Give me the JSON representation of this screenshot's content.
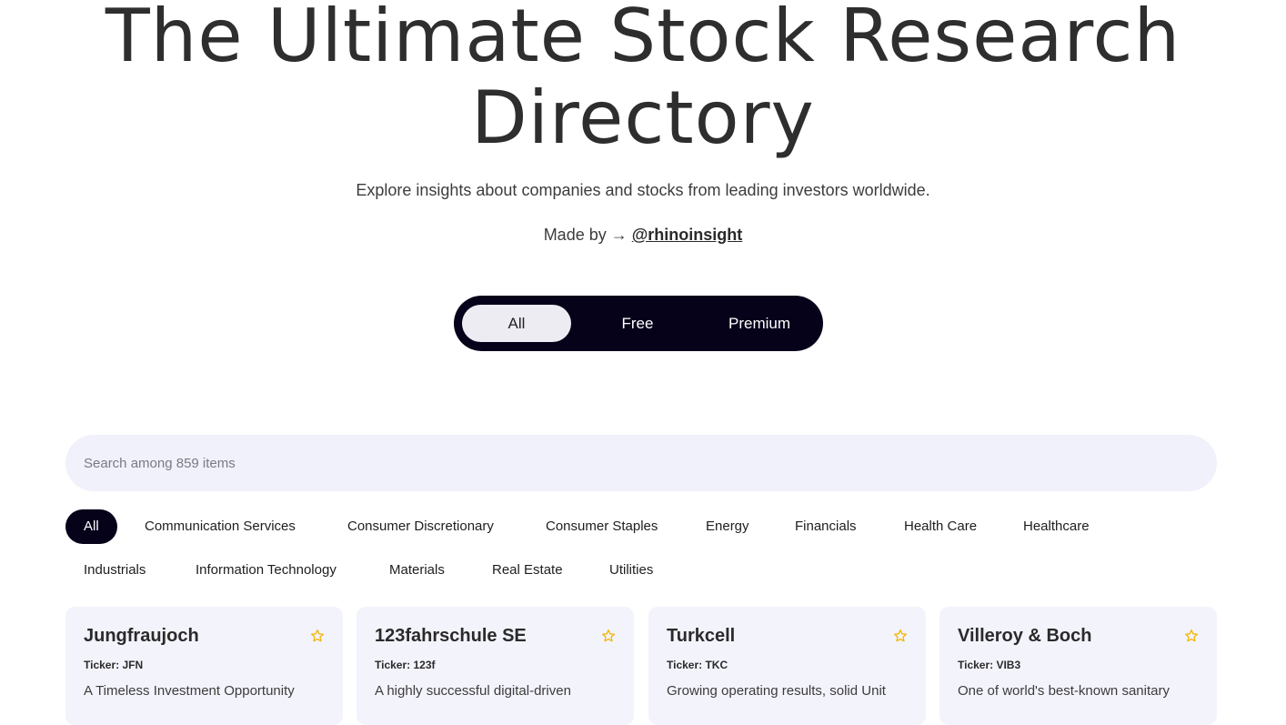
{
  "hero": {
    "title_line1": "The Ultimate Stock Research",
    "title_line2": "Directory",
    "subtitle": "Explore insights about companies and stocks from leading investors worldwide.",
    "made_by_label": "Made by →",
    "made_by_handle": "@rhinoinsight"
  },
  "toggle": {
    "options": [
      "All",
      "Free",
      "Premium"
    ],
    "selected": "All"
  },
  "search": {
    "placeholder": "Search among 859 items",
    "value": ""
  },
  "categories": {
    "selected": "All",
    "items": [
      "All",
      "Communication Services",
      "Consumer Discretionary",
      "Consumer Staples",
      "Energy",
      "Financials",
      "Health Care",
      "Healthcare",
      "Industrials",
      "Information Technology",
      "Materials",
      "Real Estate",
      "Utilities"
    ]
  },
  "cards": [
    {
      "name": "Jungfraujoch",
      "ticker": "Ticker: JFN",
      "description": "A Timeless Investment Opportunity"
    },
    {
      "name": "123fahrschule SE",
      "ticker": "Ticker: 123f",
      "description": "A highly successful digital-driven"
    },
    {
      "name": "Turkcell",
      "ticker": "Ticker: TKC",
      "description": "Growing operating results, solid Unit"
    },
    {
      "name": "Villeroy & Boch",
      "ticker": "Ticker: VIB3",
      "description": "One of world's best-known sanitary"
    }
  ],
  "colors": {
    "accent_dark": "#05021a",
    "card_bg": "#f3f3fc",
    "star": "#f2b705"
  }
}
